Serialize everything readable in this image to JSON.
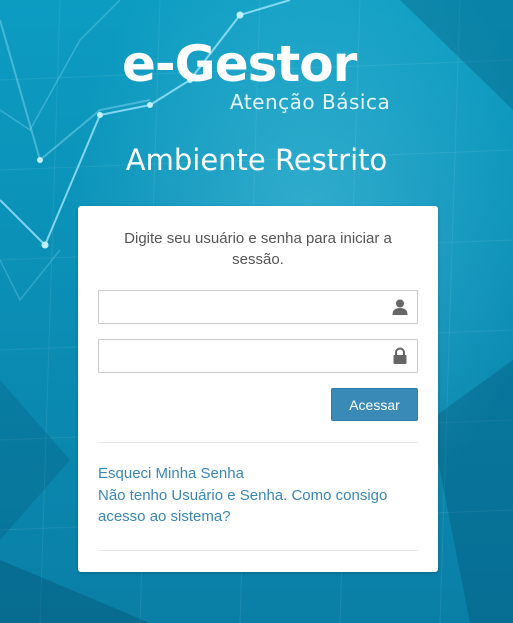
{
  "brand": {
    "name": "e-Gestor",
    "subtitle": "Atenção Básica"
  },
  "page_title": "Ambiente Restrito",
  "login": {
    "intro_text": "Digite seu usuário e senha para iniciar a sessão.",
    "username": {
      "value": "",
      "placeholder": "",
      "icon": "user-icon"
    },
    "password": {
      "value": "",
      "placeholder": "",
      "icon": "lock-icon"
    },
    "submit_label": "Acessar"
  },
  "links": {
    "forgot_password": "Esqueci Minha Senha",
    "no_account": "Não tenho Usuário e Senha. Como consigo acesso ao sistema?"
  },
  "colors": {
    "background": "#0a8fb5",
    "button": "#3a8ab8",
    "link": "#3a87b5"
  }
}
